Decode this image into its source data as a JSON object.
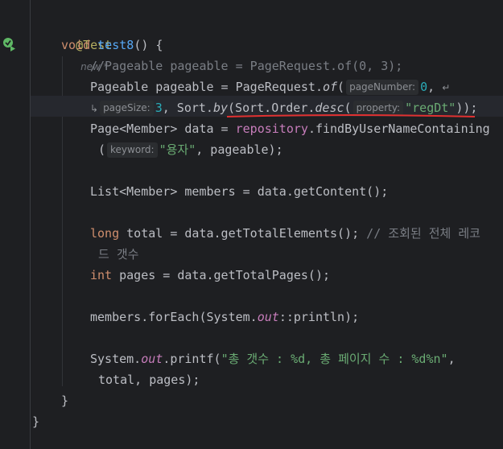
{
  "code": {
    "l1_annotation": "@Test",
    "l1_meta": "new *",
    "l2_kw": "void",
    "l2_name": "test8",
    "l2_rest": "() {",
    "l3_comment": "//Pageable pageable = PageRequest.of(0, 3);",
    "l4_a": "Pageable pageable = PageRequest.",
    "l4_of": "of",
    "l4_paren": "(",
    "l4_hint": "pageNumber:",
    "l4_num": "0",
    "l4_comma": ",",
    "l5_hint1": "pageSize:",
    "l5_num": "3",
    "l5_a": ", Sort.",
    "l5_by": "by",
    "l5_b": "(Sort.Order.",
    "l5_desc": "desc",
    "l5_c": "(",
    "l5_hint2": "property:",
    "l5_str": "\"regDt\"",
    "l5_end": "));",
    "l6_a": "Page<Member> data = ",
    "l6_repo": "repository",
    "l6_b": ".findByUserNameContaining",
    "l7_a": "(",
    "l7_hint": "keyword:",
    "l7_str": "\"용자\"",
    "l7_b": ", pageable);",
    "l9": "List<Member> members = data.getContent();",
    "l11_kw": "long",
    "l11_a": " total = data.getTotalElements(); ",
    "l11_cmt": "// 조회된 전체 레코",
    "l12_cmt": "드 갯수",
    "l13_kw": "int",
    "l13_a": " pages = data.getTotalPages();",
    "l15_a": "members.forEach(System.",
    "l15_out": "out",
    "l15_b": "::println);",
    "l17_a": "System.",
    "l17_out": "out",
    "l17_b": ".printf(",
    "l17_str": "\"총 갯수 : %d, 총 페이지 수 : %d%n\"",
    "l17_c": ",",
    "l18": "total, pages);",
    "l19": "}",
    "l20": "}"
  },
  "icons": {
    "run": "run-test-icon",
    "wrap": "soft-wrap-icon"
  },
  "colors": {
    "background": "#1e1f22",
    "keyword": "#cf8e6d",
    "function": "#56a8f5",
    "string": "#6aab73",
    "number": "#2aacb8",
    "comment": "#7a7e85",
    "annotation": "#b3ae60",
    "field": "#c77dbb",
    "error_underline": "#e03131"
  }
}
